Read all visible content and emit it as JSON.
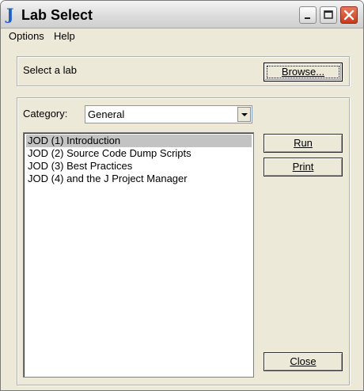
{
  "window": {
    "app_icon": "J",
    "title": "Lab Select"
  },
  "menu": {
    "options": "Options",
    "help": "Help"
  },
  "lab_select": {
    "prompt": "Select a lab",
    "browse_label": "Browse..."
  },
  "category": {
    "label": "Category:",
    "value": "General"
  },
  "labs": [
    "JOD (1) Introduction",
    "JOD (2) Source Code Dump Scripts",
    "JOD (3) Best Practices",
    "JOD (4) and the J Project Manager"
  ],
  "selected_index": 0,
  "buttons": {
    "run": "Run",
    "print": "Print",
    "close": "Close"
  },
  "icons": {
    "minimize": "minimize-icon",
    "maximize": "maximize-icon",
    "close": "close-icon",
    "dropdown": "chevron-down-icon"
  }
}
